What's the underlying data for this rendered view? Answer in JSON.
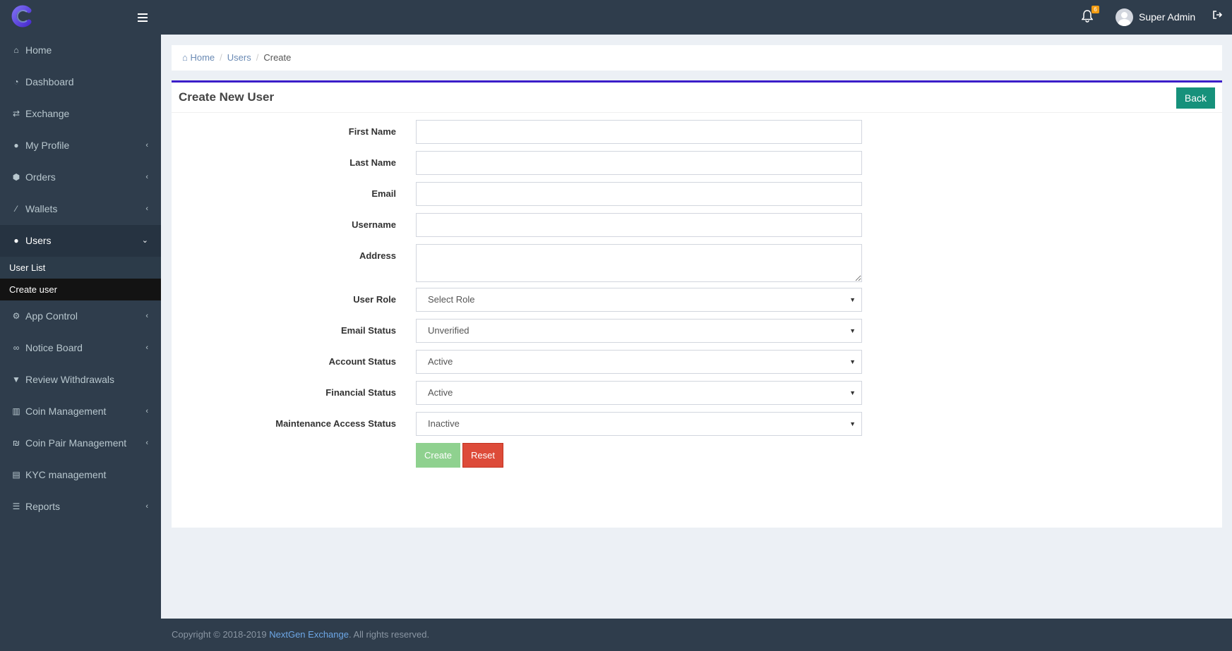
{
  "sidebar": {
    "logo": "logo-icon",
    "items": [
      {
        "label": "Home",
        "icon": "home-icon",
        "has_children": false
      },
      {
        "label": "Dashboard",
        "icon": "dashboard-icon",
        "has_children": false
      },
      {
        "label": "Exchange",
        "icon": "exchange-icon",
        "has_children": false
      },
      {
        "label": "My Profile",
        "icon": "user-icon",
        "has_children": true
      },
      {
        "label": "Orders",
        "icon": "cube-icon",
        "has_children": true
      },
      {
        "label": "Wallets",
        "icon": "magic-wand-icon",
        "has_children": true
      },
      {
        "label": "Users",
        "icon": "users-icon",
        "has_children": true,
        "expanded": true
      },
      {
        "label": "App Control",
        "icon": "gear-icon",
        "has_children": true
      },
      {
        "label": "Notice Board",
        "icon": "binoculars-icon",
        "has_children": true
      },
      {
        "label": "Review Withdrawals",
        "icon": "filter-icon",
        "has_children": false
      },
      {
        "label": "Coin Management",
        "icon": "bar-chart-icon",
        "has_children": true
      },
      {
        "label": "Coin Pair Management",
        "icon": "currency-icon",
        "has_children": true
      },
      {
        "label": "KYC management",
        "icon": "id-card-icon",
        "has_children": false
      },
      {
        "label": "Reports",
        "icon": "list-icon",
        "has_children": true
      }
    ],
    "users_submenu": [
      {
        "label": "User List"
      },
      {
        "label": "Create user",
        "current": true
      }
    ]
  },
  "topbar": {
    "notification_count": "6",
    "user_name": "Super Admin"
  },
  "breadcrumb": {
    "home": "Home",
    "users": "Users",
    "current": "Create"
  },
  "form": {
    "title": "Create New User",
    "back_label": "Back",
    "fields": {
      "first_name": {
        "label": "First Name",
        "value": ""
      },
      "last_name": {
        "label": "Last Name",
        "value": ""
      },
      "email": {
        "label": "Email",
        "value": ""
      },
      "username": {
        "label": "Username",
        "value": ""
      },
      "address": {
        "label": "Address",
        "value": ""
      },
      "user_role": {
        "label": "User Role",
        "selected": "Select Role"
      },
      "email_status": {
        "label": "Email Status",
        "selected": "Unverified"
      },
      "account_status": {
        "label": "Account Status",
        "selected": "Active"
      },
      "financial_status": {
        "label": "Financial Status",
        "selected": "Active"
      },
      "maintenance_status": {
        "label": "Maintenance Access Status",
        "selected": "Inactive"
      }
    },
    "create_label": "Create",
    "reset_label": "Reset"
  },
  "footer": {
    "prefix": "Copyright © 2018-2019 ",
    "link": "NextGen Exchange",
    "suffix": ". All rights reserved."
  },
  "colors": {
    "sidebar_bg": "#2f3d4c",
    "box_accent": "#3c1ec9",
    "back_button": "#16917b",
    "create_button": "#8fd18f",
    "reset_button": "#dd4b39",
    "badge": "#f39c12"
  }
}
